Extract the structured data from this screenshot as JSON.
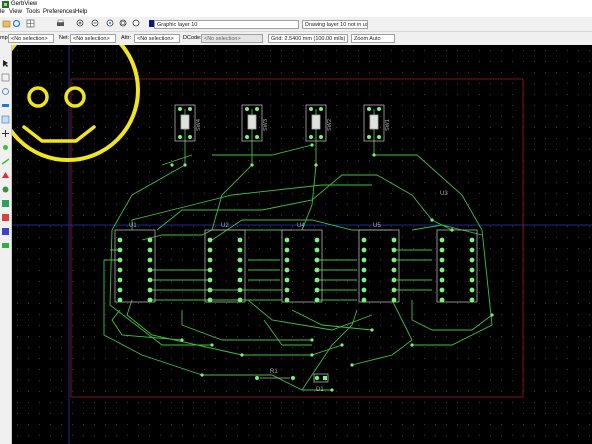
{
  "window": {
    "title": "GerbView"
  },
  "menu": {
    "items": [
      "le",
      "View",
      "Tools",
      "Preferences",
      "Help"
    ]
  },
  "toolbar": {
    "layer_select": "Graphic layer 10",
    "layer_status": "Drawing layer 10 not in use"
  },
  "selectbar": {
    "cmp_label": "mp:",
    "cmp_value": "<No selection>",
    "net_label": "Net:",
    "net_value": "<No selection>",
    "attr_label": "Attr:",
    "attr_value": "<No selection>",
    "dcode_label": "DCode:",
    "dcode_value": "<No selection>",
    "grid_value": "Grid: 2.5400 mm (100.00 mils)",
    "zoom_value": "Zoom Auto"
  },
  "board": {
    "components": [
      {
        "ref": "U1"
      },
      {
        "ref": "U2"
      },
      {
        "ref": "U4"
      },
      {
        "ref": "U5"
      },
      {
        "ref": "U3"
      }
    ],
    "switches": [
      "SW4",
      "SW3",
      "SW2",
      "SW1"
    ],
    "passives": {
      "resistor": "R1",
      "diode": "D1"
    }
  },
  "colors": {
    "canvas_bg": "#000000",
    "copper": "#3fbf3f",
    "pad": "#7df07d",
    "outline": "#b0b0b0",
    "board_edge": "#9a1b1b",
    "smiley": "#f2e51c",
    "axis": "#1e2a8a"
  },
  "icons": [
    "gerbview-app-icon",
    "open-file-icon",
    "refresh-icon",
    "print-icon",
    "zoom-in-icon",
    "zoom-out-icon",
    "zoom-redraw-icon",
    "zoom-fit-icon",
    "zoom-selection-icon",
    "layer-color-icon"
  ]
}
